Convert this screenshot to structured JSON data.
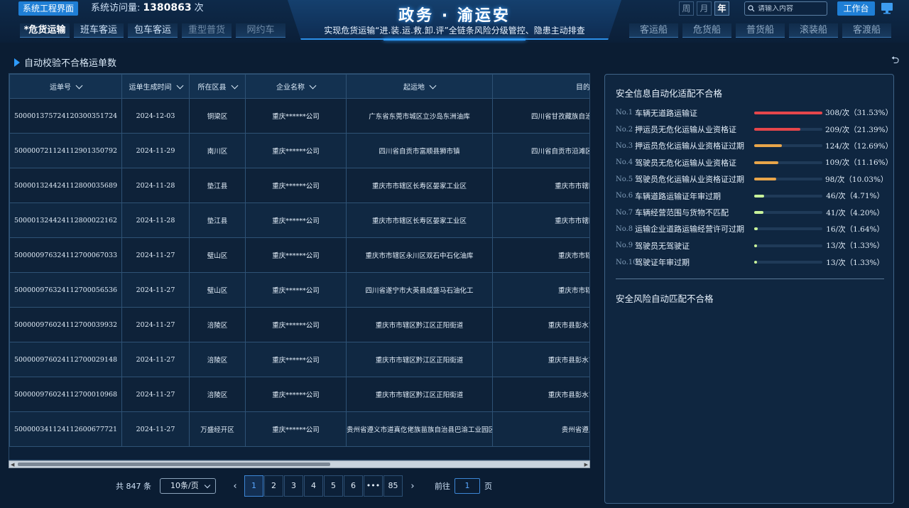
{
  "header": {
    "system_button": "系统工程界面",
    "visits_label": "系统访问量:",
    "visits_value": "1380863",
    "visits_unit": "次",
    "title": "政务 · 渝运安",
    "subtitle": "实现危货运输“进.装.运.救.卸.评”全链条风险分级管控、隐患主动排查",
    "period": [
      "周",
      "月",
      "年"
    ],
    "period_active": "年",
    "search_placeholder": "请输入内容",
    "work_button": "工作台"
  },
  "nav_left": [
    "*危货运输",
    "班车客运",
    "包车客运",
    "重型普货",
    "网约车"
  ],
  "nav_right": [
    "客运船",
    "危货船",
    "普货船",
    "滚装船",
    "客渡船"
  ],
  "section_title": "自动校验不合格运单数",
  "table": {
    "columns": [
      "运单号",
      "运单生成时间",
      "所在区县",
      "企业名称",
      "起运地",
      "目的地"
    ],
    "rows": [
      [
        "500001375724120300351724",
        "2024-12-03",
        "铜梁区",
        "重庆******公司",
        "广东省东莞市城区立沙岛东洲油库",
        "四川省甘孜藏族自治州香格里拉市迪庆市"
      ],
      [
        "500000721124112901350792",
        "2024-11-29",
        "南川区",
        "重庆******公司",
        "四川省自贡市富顺县狮市镇",
        "四川省自贡市沿滩区四川省自贡市沿滩区"
      ],
      [
        "500001324424112800035689",
        "2024-11-28",
        "垫江县",
        "重庆******公司",
        "重庆市市辖区长寿区晏家工业区",
        "重庆市市辖区长寿区晏家"
      ],
      [
        "500001324424112800022162",
        "2024-11-28",
        "垫江县",
        "重庆******公司",
        "重庆市市辖区长寿区晏家工业区",
        "重庆市市辖区长寿区晏家"
      ],
      [
        "500000976324112700067033",
        "2024-11-27",
        "璧山区",
        "重庆******公司",
        "重庆市市辖区永川区双石中石化油库",
        "重庆市市辖区渝北区鹿"
      ],
      [
        "500000976324112700056536",
        "2024-11-27",
        "璧山区",
        "重庆******公司",
        "四川省遂宁市大英县成盛马石油化工",
        "重庆市市辖区渝北区鹿"
      ],
      [
        "500000976024112700039932",
        "2024-11-27",
        "涪陵区",
        "重庆******公司",
        "重庆市市辖区黔江区正阳街道",
        "重庆市县彭水苗族土家族自治"
      ],
      [
        "500000976024112700029148",
        "2024-11-27",
        "涪陵区",
        "重庆******公司",
        "重庆市市辖区黔江区正阳街道",
        "重庆市县彭水苗族土家族自治"
      ],
      [
        "500000976024112700010968",
        "2024-11-27",
        "涪陵区",
        "重庆******公司",
        "重庆市市辖区黔江区正阳街道",
        "重庆市县彭水苗族土家族自治"
      ],
      [
        "500000341124112600677721",
        "2024-11-27",
        "万盛经开区",
        "重庆******公司",
        "贵州省遵义市道真仡佬族苗族自治县巴渝工业园区",
        "贵州省遵义市仁怀市"
      ]
    ]
  },
  "pagination": {
    "total": "共 847 条",
    "page_size": "10条/页",
    "pages": [
      "1",
      "2",
      "3",
      "4",
      "5",
      "6",
      "•••",
      "85"
    ],
    "active_page": "1",
    "goto_label": "前往",
    "goto_value": "1",
    "goto_unit": "页"
  },
  "panel": {
    "title1": "安全信息自动化适配不合格",
    "title2": "安全风险自动匹配不合格",
    "items": [
      {
        "no": "No.1",
        "label": "车辆无道路运输证",
        "value": "308/次（31.53%）",
        "pct": 31.53,
        "color": "#e5464b"
      },
      {
        "no": "No.2",
        "label": "押运员无危化运输从业资格证",
        "value": "209/次（21.39%）",
        "pct": 21.39,
        "color": "#e5464b"
      },
      {
        "no": "No.3",
        "label": "押运员危化运输从业资格证过期",
        "value": "124/次（12.69%）",
        "pct": 12.69,
        "color": "#e8a54a"
      },
      {
        "no": "No.4",
        "label": "驾驶员无危化运输从业资格证",
        "value": "109/次（11.16%）",
        "pct": 11.16,
        "color": "#e8a54a"
      },
      {
        "no": "No.5",
        "label": "驾驶员危化运输从业资格证过期",
        "value": "98/次（10.03%）",
        "pct": 10.03,
        "color": "#e8a54a"
      },
      {
        "no": "No.6",
        "label": "车辆道路运输证年审过期",
        "value": "46/次（4.71%）",
        "pct": 4.71,
        "color": "#c8f29a"
      },
      {
        "no": "No.7",
        "label": "车辆经营范围与货物不匹配",
        "value": "41/次（4.20%）",
        "pct": 4.2,
        "color": "#c8f29a"
      },
      {
        "no": "No.8",
        "label": "运输企业道路运输经营许可过期",
        "value": "16/次（1.64%）",
        "pct": 1.64,
        "color": "#c8f29a"
      },
      {
        "no": "No.9",
        "label": "驾驶员无驾驶证",
        "value": "13/次（1.33%）",
        "pct": 1.33,
        "color": "#c8f29a"
      },
      {
        "no": "No.10",
        "label": "驾驶证年审过期",
        "value": "13/次（1.33%）",
        "pct": 1.33,
        "color": "#c8f29a"
      }
    ]
  }
}
